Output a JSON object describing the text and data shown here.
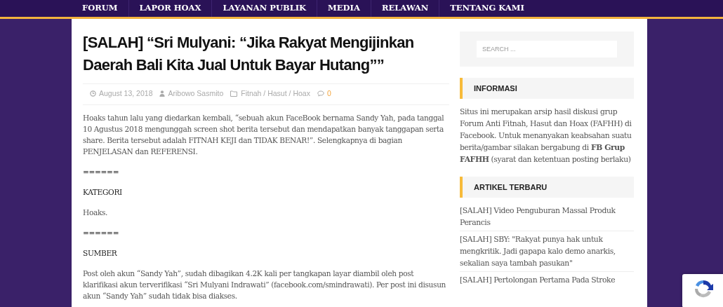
{
  "nav": {
    "items": [
      {
        "label": "FORUM"
      },
      {
        "label": "LAPOR HOAX"
      },
      {
        "label": "LAYANAN PUBLIK"
      },
      {
        "label": "MEDIA"
      },
      {
        "label": "RELAWAN"
      },
      {
        "label": "TENTANG KAMI"
      }
    ]
  },
  "article": {
    "title": "[SALAH] “Sri Mulyani: “Jika Rakyat Mengijinkan Daerah Bali Kita Jual Untuk Bayar Hutang””",
    "meta": [
      {
        "kind": "date",
        "text": "August 13, 2018"
      },
      {
        "kind": "author",
        "text": "Aribowo Sasmito"
      },
      {
        "kind": "category",
        "text": "Fitnah / Hasut / Hoax"
      },
      {
        "kind": "comments",
        "text": "0"
      }
    ],
    "blocks": [
      {
        "kind": "paragraph",
        "text": "Hoaks tahun lalu yang diedarkan kembali, “sebuah akun FaceBook bernama Sandy Yah, pada tanggal 10 Agustus 2018 mengunggah screen shot berita tersebut dan mendapatkan banyak tanggapan serta share. Berita tersebut adalah FITNAH KEJI dan TIDAK BENAR!”. Selengkapnya di bagian PENJELASAN dan REFERENSI."
      },
      {
        "kind": "separator",
        "text": "======"
      },
      {
        "kind": "heading",
        "text": "KATEGORI"
      },
      {
        "kind": "paragraph",
        "text": "Hoaks."
      },
      {
        "kind": "separator",
        "text": "======"
      },
      {
        "kind": "heading",
        "text": "SUMBER"
      },
      {
        "kind": "paragraph",
        "text": "Post oleh akun “Sandy Yah”, sudah dibagikan 4.2K kali per tangkapan layar diambil oleh post klarifikasi akun terverifikasi “Sri Mulyani Indrawati” (facebook.com/smindrawati). Per post ini disusun akun “Sandy Yah” sudah tidak bisa diakses."
      }
    ]
  },
  "sidebar": {
    "search": {
      "placeholder": "SEARCH ..."
    },
    "widgets": [
      {
        "kind": "text",
        "title": "INFORMASI",
        "text": "Situs ini merupakan arsip hasil diskusi grup Forum Anti Fitnah, Hasut dan Hoax (FAFHH) di Facebook. Untuk menanyakan keabsahan suatu berita/gambar silakan bergabung di **FB Grup FAFHH** (syarat dan ketentuan posting berlaku)"
      },
      {
        "kind": "list",
        "title": "ARTIKEL TERBARU",
        "items": [
          "[SALAH] Video Penguburan Massal Produk Perancis",
          "[SALAH] SBY: \"Rakyat punya hak untuk mengkritik. Jadi gapapa kalo demo anarkis, sekalian saya tambah pasukan\"",
          "[SALAH] Pertolongan Pertama Pada Stroke"
        ]
      }
    ]
  }
}
